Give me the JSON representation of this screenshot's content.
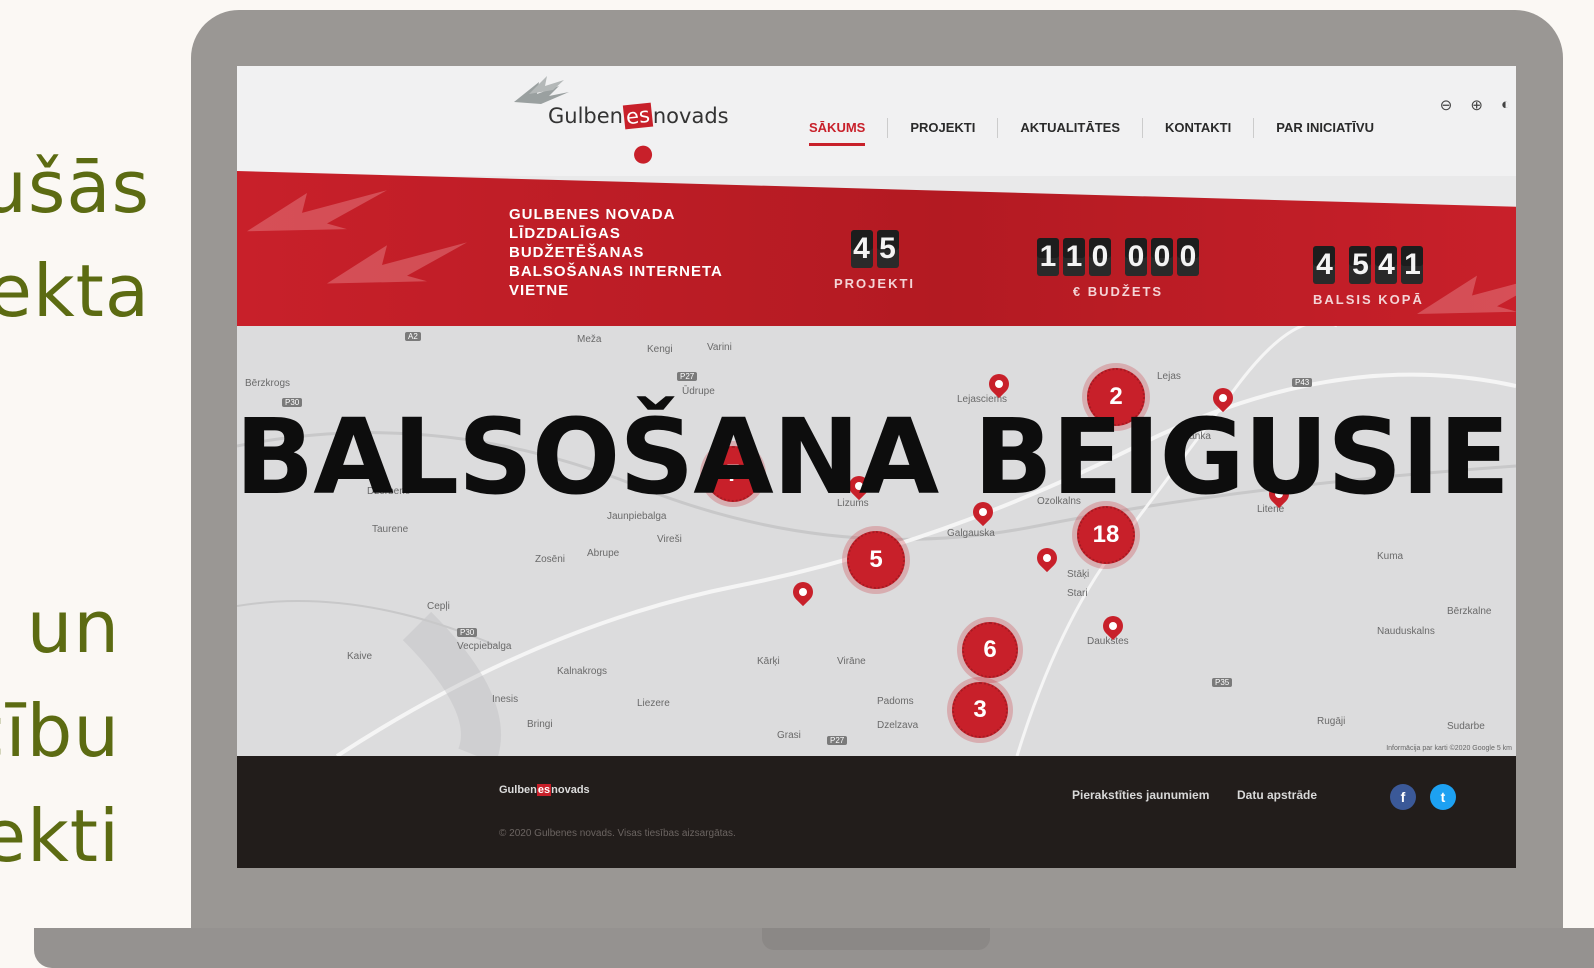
{
  "side_text_top": [
    "ušās",
    "ekta"
  ],
  "side_text_bottom": [
    "un",
    "cību",
    "ekti"
  ],
  "header": {
    "logo": {
      "left": "Gulben",
      "middle": "es",
      "right": "novads"
    },
    "nav": [
      "SĀKUMS",
      "PROJEKTI",
      "AKTUALITĀTES",
      "KONTAKTI",
      "PAR INICIATĪVU"
    ],
    "active_nav": "SĀKUMS",
    "tools": [
      "zoom-out-icon",
      "zoom-in-icon",
      "contrast-icon"
    ]
  },
  "banner": {
    "title": "GULBENES NOVADA LĪDZDALĪGAS BUDŽETĒŠANAS BALSOŠANAS INTERNETA VIETNE",
    "counters": [
      {
        "value": "45",
        "label": "PROJEKTI"
      },
      {
        "value": "110 000",
        "label": "€ BUDŽETS"
      },
      {
        "value": "4 541",
        "label": "BALSIS KOPĀ"
      }
    ],
    "color": "#c8202a"
  },
  "map": {
    "overlay": "BALSOŠANA BEIGUSIES!",
    "labels": [
      "Meža",
      "Lejasciems",
      "Lizums",
      "Galgauska",
      "Ozolkalns",
      "Stāķi",
      "Stari",
      "Jaunpiebalga",
      "Vireši",
      "Zosēni",
      "Abrupe",
      "Taurene",
      "Dzērbene",
      "Cepļi",
      "Vecpiebalga",
      "Kalnakrogs",
      "Kaive",
      "Inesis",
      "Bringi",
      "Liezere",
      "Kārķi",
      "Virāne",
      "Padoms",
      "Dzelzava",
      "Grasi",
      "Daukstes",
      "Lejas",
      "Ranka",
      "Litene",
      "Kuma",
      "Nauduskalns",
      "Bērzkalne",
      "Sudarbe",
      "Rugāji",
      "Bērzkrogs",
      "Kengi",
      "Varini",
      "Ūdrupe"
    ],
    "clusters": [
      "2",
      "18",
      "5",
      "6",
      "3",
      "7"
    ],
    "credit": "Informācija par karti ©2020 Google  5 km"
  },
  "footer": {
    "logo": {
      "left": "Gulben",
      "middle": "es",
      "right": "novads"
    },
    "copyright": "© 2020 Gulbenes novads. Visas tiesības aizsargātas.",
    "links": [
      "Pierakstīties jaunumiem",
      "Datu apstrāde"
    ],
    "social": [
      {
        "name": "facebook-icon",
        "glyph": "f",
        "color": "#3b5998"
      },
      {
        "name": "twitter-icon",
        "glyph": "t",
        "color": "#1da1f2"
      }
    ]
  }
}
